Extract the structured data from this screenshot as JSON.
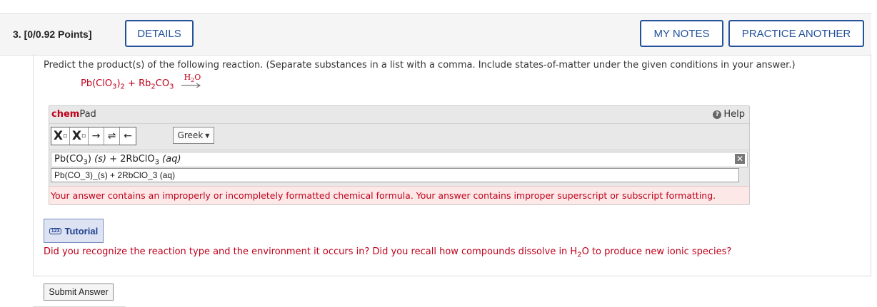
{
  "question": {
    "number": "3.",
    "points": "[0/0.92 Points]",
    "details_label": "DETAILS",
    "my_notes_label": "MY NOTES",
    "practice_another_label": "PRACTICE ANOTHER"
  },
  "prompt": "Predict the product(s) of the following reaction. (Separate substances in a list with a comma. Include states-of-matter under the given conditions in your answer.)",
  "reaction": {
    "reactant1_a": "Pb(ClO",
    "reactant1_sub1": "3",
    "reactant1_b": ")",
    "reactant1_sub2": "2",
    "plus": " + Rb",
    "reactant2_sub1": "2",
    "reactant2_b": "CO",
    "reactant2_sub2": "3",
    "arrow_label_h": "H",
    "arrow_label_sub": "2",
    "arrow_label_o": "O"
  },
  "chempad": {
    "title_chem": "chem",
    "title_pad": "Pad",
    "help_label": "Help",
    "greek_label": "Greek",
    "rendered": {
      "p1": "Pb(CO",
      "s1": "3",
      "p2": ")",
      "state1": "(s)",
      "p3": " + 2RbClO",
      "s2": "3",
      "state2": "(aq)"
    },
    "input_value": "Pb(CO_3)_(s) + 2RbClO_3 (aq)",
    "error": "Your answer contains an improperly or incompletely formatted chemical formula. Your answer contains improper superscript or subscript formatting."
  },
  "tutorial": {
    "icon_text": "123",
    "label": "Tutorial"
  },
  "feedback": {
    "part1": "Did you recognize the reaction type and the environment it occurs in? Did you recall how compounds dissolve in H",
    "sub": "2",
    "part2": "O to produce new ionic species?"
  },
  "submit_label": "Submit Answer",
  "colors": {
    "accent_blue": "#24529a",
    "error_red": "#c0001a"
  }
}
